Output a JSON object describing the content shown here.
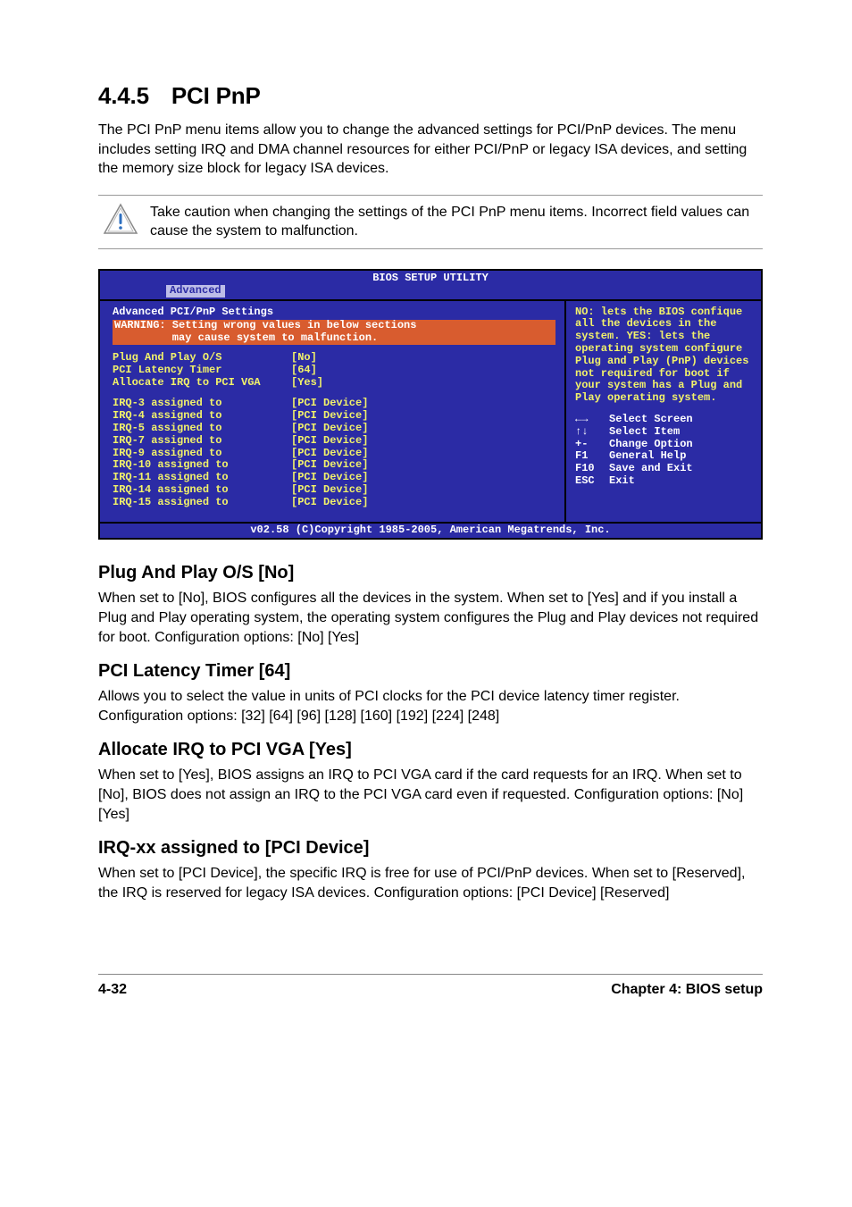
{
  "header": {
    "section_number": "4.4.5",
    "section_title": "PCI PnP",
    "intro": "The PCI PnP menu items allow you to change the advanced settings for PCI/PnP devices. The menu includes setting IRQ and DMA channel resources for either PCI/PnP or legacy ISA devices, and setting the memory size block for legacy ISA devices."
  },
  "note": "Take caution when changing the settings of the PCI PnP menu items. Incorrect field values can cause the system to malfunction.",
  "bios": {
    "title": "BIOS SETUP UTILITY",
    "tab": "Advanced",
    "section_title": "Advanced PCI/PnP Settings",
    "warning_l1": "WARNING: Setting wrong values in below sections",
    "warning_l2": "         may cause system to malfunction.",
    "group1": [
      {
        "label": "Plug And Play O/S",
        "value": "[No]"
      },
      {
        "label": "PCI Latency Timer",
        "value": "[64]"
      },
      {
        "label": "Allocate IRQ to PCI VGA",
        "value": "[Yes]"
      }
    ],
    "group2": [
      {
        "label": "IRQ-3 assigned to",
        "value": "[PCI Device]"
      },
      {
        "label": "IRQ-4 assigned to",
        "value": "[PCI Device]"
      },
      {
        "label": "IRQ-5 assigned to",
        "value": "[PCI Device]"
      },
      {
        "label": "IRQ-7 assigned to",
        "value": "[PCI Device]"
      },
      {
        "label": "IRQ-9 assigned to",
        "value": "[PCI Device]"
      },
      {
        "label": "IRQ-10 assigned to",
        "value": "[PCI Device]"
      },
      {
        "label": "IRQ-11 assigned to",
        "value": "[PCI Device]"
      },
      {
        "label": "IRQ-14 assigned to",
        "value": "[PCI Device]"
      },
      {
        "label": "IRQ-15 assigned to",
        "value": "[PCI Device]"
      }
    ],
    "help": "NO: lets the BIOS confique all the devices in the system. YES: lets the operating system configure Plug and Play (PnP) devices not required for boot if your system has a Plug and Play operating system.",
    "nav": [
      {
        "key": "←→",
        "label": "Select Screen"
      },
      {
        "key": "↑↓",
        "label": "Select Item"
      },
      {
        "key": "+-",
        "label": "Change Option"
      },
      {
        "key": "F1",
        "label": "General Help"
      },
      {
        "key": "F10",
        "label": "Save and Exit"
      },
      {
        "key": "ESC",
        "label": "Exit"
      }
    ],
    "footer": "v02.58 (C)Copyright 1985-2005, American Megatrends, Inc."
  },
  "options": [
    {
      "title": "Plug And Play O/S [No]",
      "desc": "When set to [No], BIOS configures all the devices in the system. When set to [Yes] and if you install a Plug and Play operating system, the operating system configures the Plug and Play devices not required for boot. Configuration options: [No] [Yes]"
    },
    {
      "title": "PCI Latency Timer [64]",
      "desc": "Allows you to select the value in units of PCI clocks for the PCI device latency timer register. Configuration options: [32] [64] [96] [128] [160] [192] [224] [248]"
    },
    {
      "title": "Allocate IRQ to PCI VGA [Yes]",
      "desc": "When set to [Yes], BIOS assigns an IRQ to PCI VGA card if the card requests for an IRQ. When set to [No], BIOS does not assign an IRQ to the PCI VGA card even if requested. Configuration options: [No] [Yes]"
    },
    {
      "title": "IRQ-xx assigned to [PCI Device]",
      "desc": "When set to [PCI Device], the specific IRQ is free for use of PCI/PnP devices. When set to [Reserved], the IRQ is reserved for legacy ISA devices. Configuration options: [PCI Device] [Reserved]"
    }
  ],
  "footer": {
    "page": "4-32",
    "chapter": "Chapter 4: BIOS setup"
  }
}
